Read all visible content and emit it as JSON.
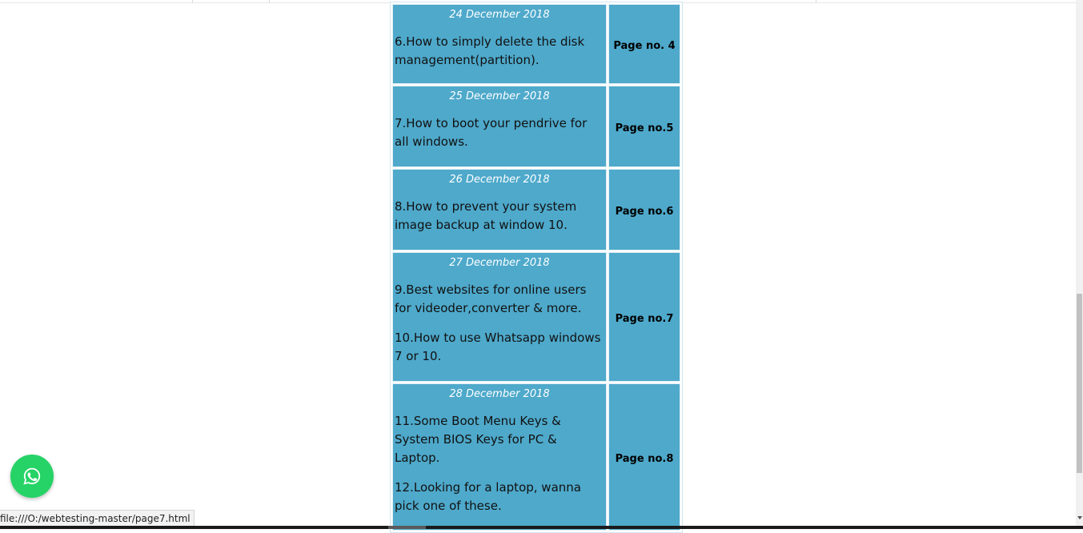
{
  "posts": [
    {
      "date": "24 December 2018",
      "titles": [
        "6.How to simply delete the disk management(partition)."
      ],
      "page_label": "Page no. 4"
    },
    {
      "date": "25 December 2018",
      "titles": [
        "7.How to boot your pendrive for all windows."
      ],
      "page_label": "Page no.5"
    },
    {
      "date": "26 December 2018",
      "titles": [
        "8.How to prevent your system image backup at window 10."
      ],
      "page_label": "Page no.6"
    },
    {
      "date": "27 December 2018",
      "titles": [
        "9.Best websites for online users for videoder,converter & more.",
        "10.How to use Whatsapp windows 7 or 10."
      ],
      "page_label": "Page no.7"
    },
    {
      "date": "28 December 2018",
      "titles": [
        "11.Some Boot Menu Keys & System BIOS Keys for PC & Laptop.",
        "12.Looking for a laptop, wanna pick one of these."
      ],
      "page_label": "Page no.8"
    }
  ],
  "status_bar": {
    "url": "file:///O:/webtesting-master/page7.html"
  },
  "whatsapp": {
    "icon": "whatsapp-icon"
  },
  "colors": {
    "cell_background": "#4ea9cb",
    "whatsapp_green": "#25d366"
  }
}
